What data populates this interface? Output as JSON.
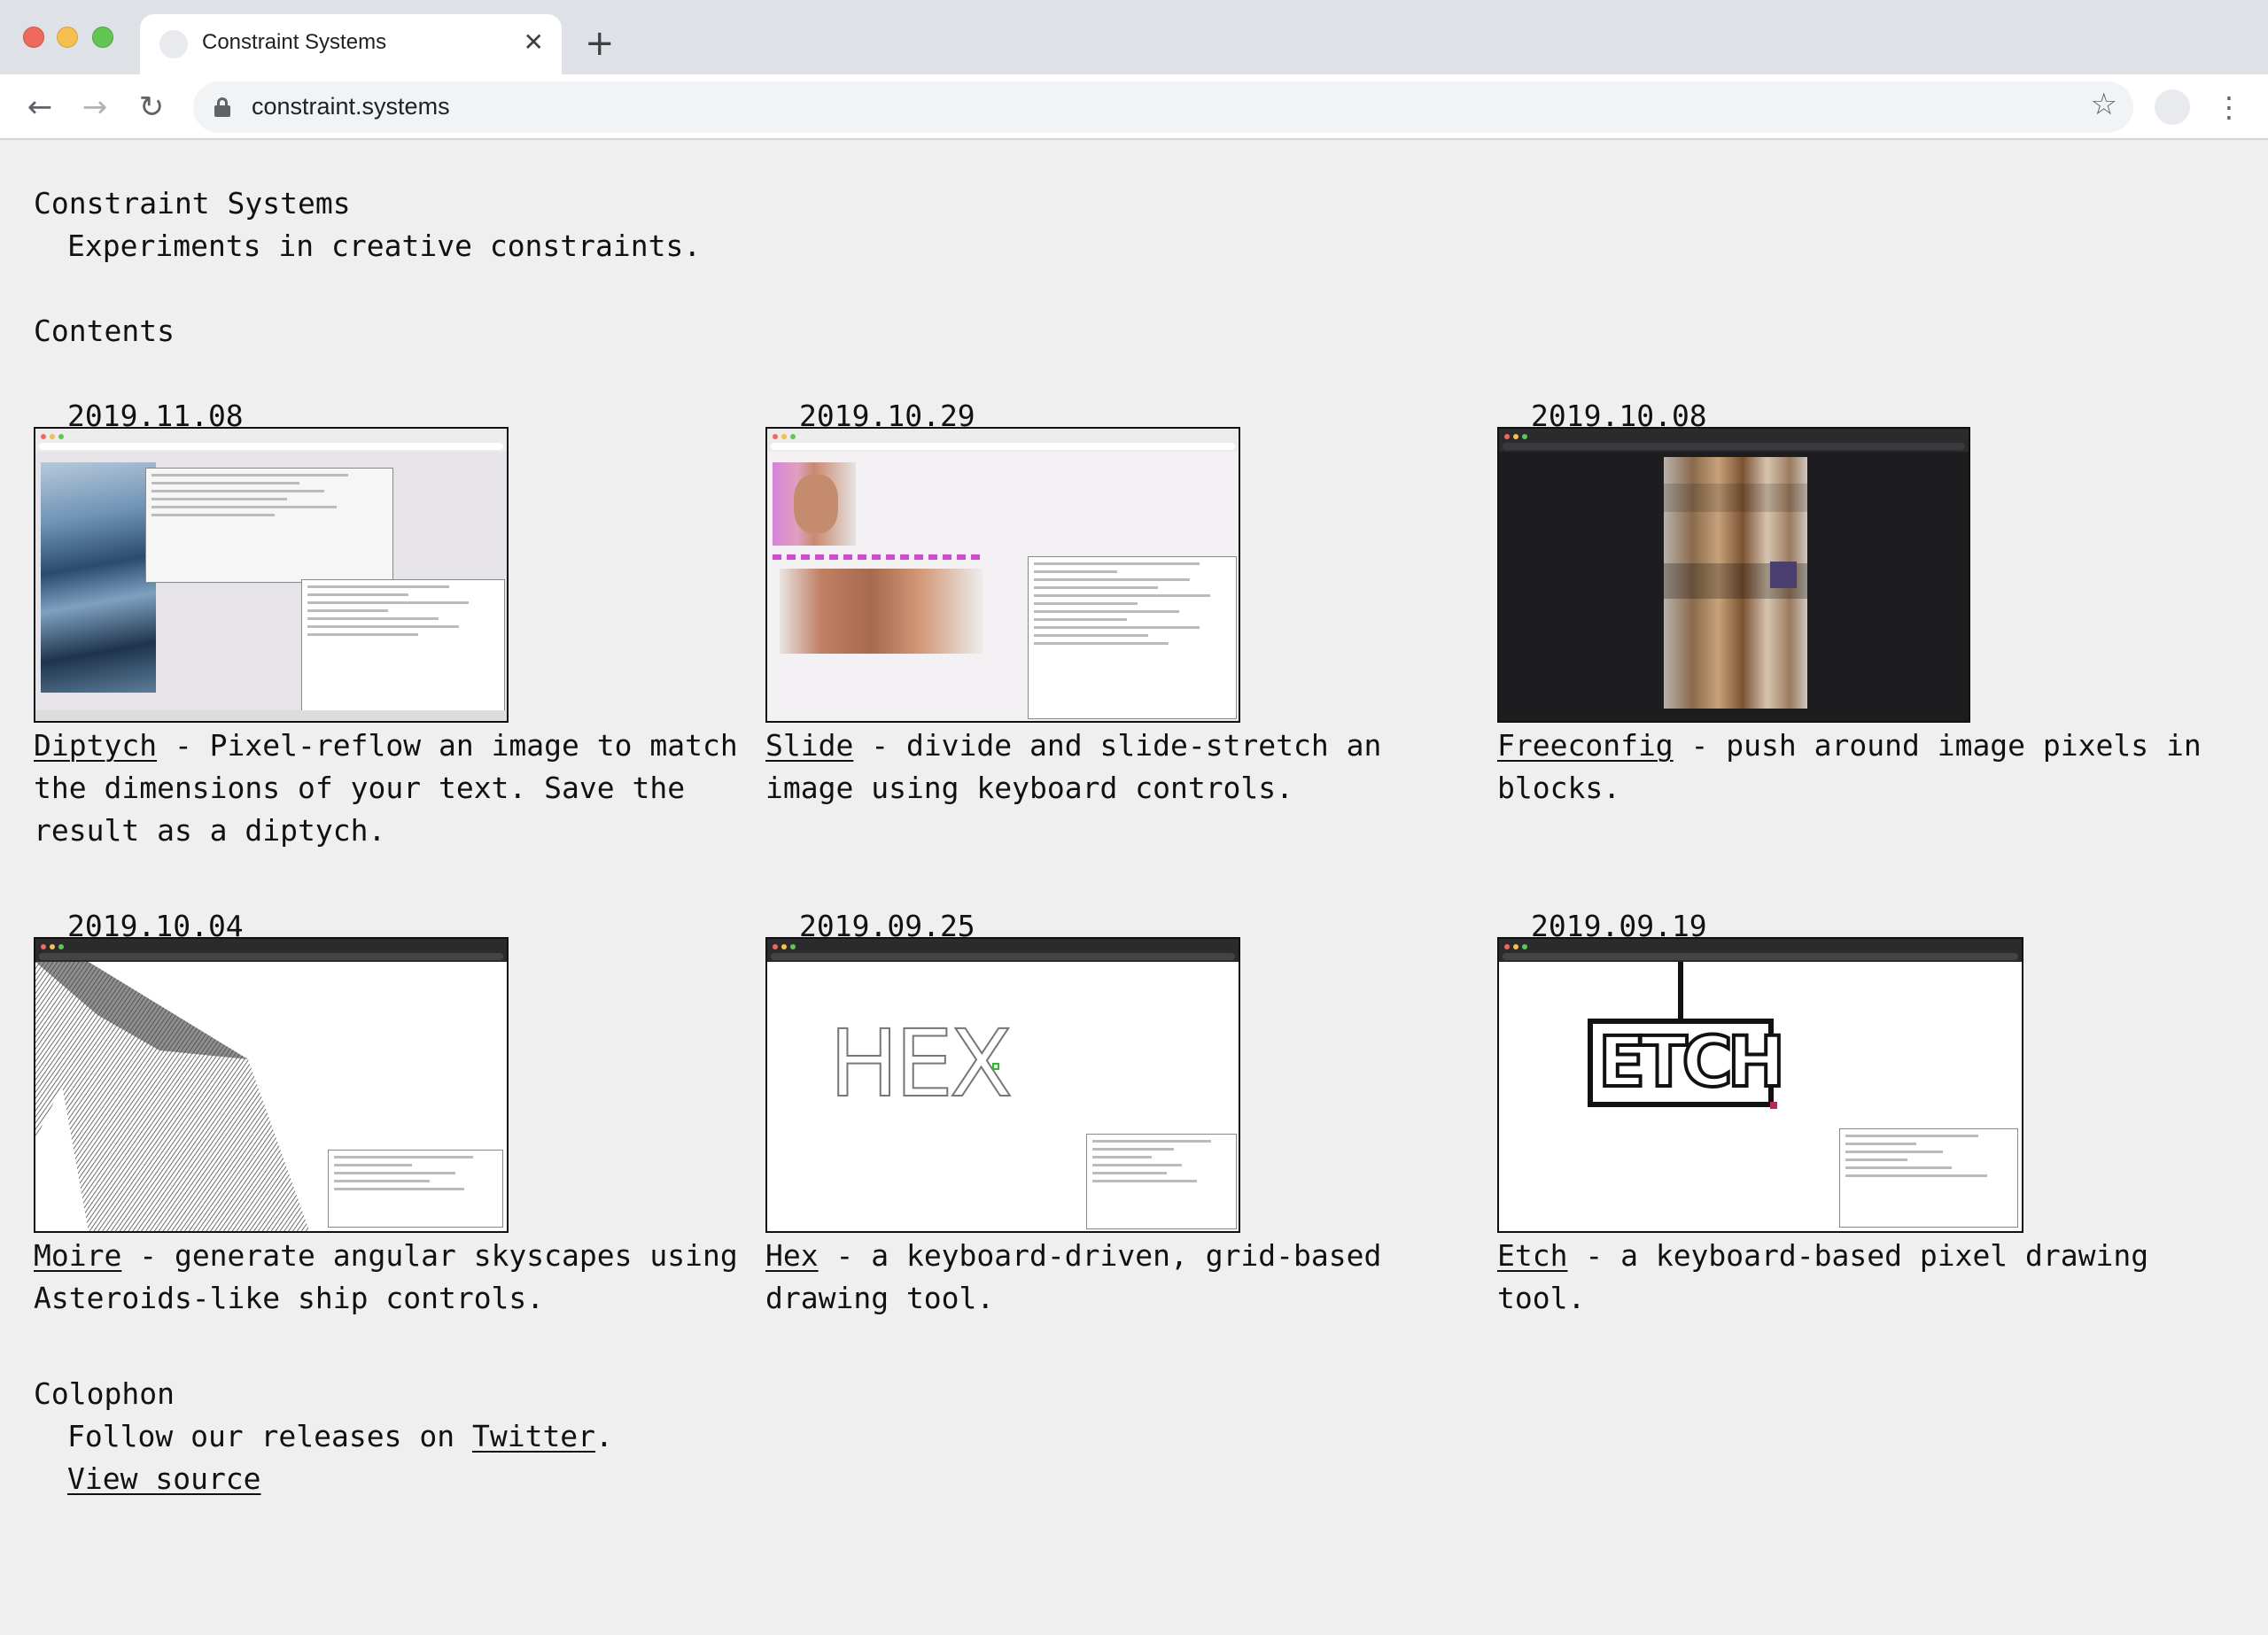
{
  "browser": {
    "tab_title": "Constraint Systems",
    "url": "constraint.systems",
    "tab_close_glyph": "✕",
    "new_tab_glyph": "+",
    "back_glyph": "←",
    "forward_glyph": "→",
    "reload_glyph": "↻",
    "star_glyph": "☆",
    "menu_glyph": "⋮"
  },
  "header": {
    "title": "Constraint Systems",
    "subtitle": "Experiments in creative constraints."
  },
  "contents_heading": "Contents",
  "entries": [
    {
      "date": "2019.11.08",
      "name": "Diptych",
      "text": " - Pixel-reflow an image to match the dimensions of your text. Save the result as a diptych."
    },
    {
      "date": "2019.10.29",
      "name": "Slide",
      "text": " - divide and slide-stretch an image using keyboard controls."
    },
    {
      "date": "2019.10.08",
      "name": "Freeconfig",
      "text": " - push around image pixels in blocks."
    },
    {
      "date": "2019.10.04",
      "name": "Moire",
      "text": " - generate angular skyscapes using Asteroids-like ship controls."
    },
    {
      "date": "2019.09.25",
      "name": "Hex",
      "text": " - a keyboard-driven, grid-based drawing tool."
    },
    {
      "date": "2019.09.19",
      "name": "Etch",
      "text": " - a keyboard-based pixel drawing tool."
    }
  ],
  "colophon": {
    "heading": "Colophon",
    "follow_prefix": "Follow our releases on ",
    "twitter": "Twitter",
    "follow_suffix": ".",
    "view_source": "View source"
  },
  "thumb_text": {
    "hex": "HEX",
    "etch": "ETCH"
  },
  "colors": {
    "page_bg": "#efefef",
    "tabbar_bg": "#dee1e6",
    "text": "#111111"
  }
}
